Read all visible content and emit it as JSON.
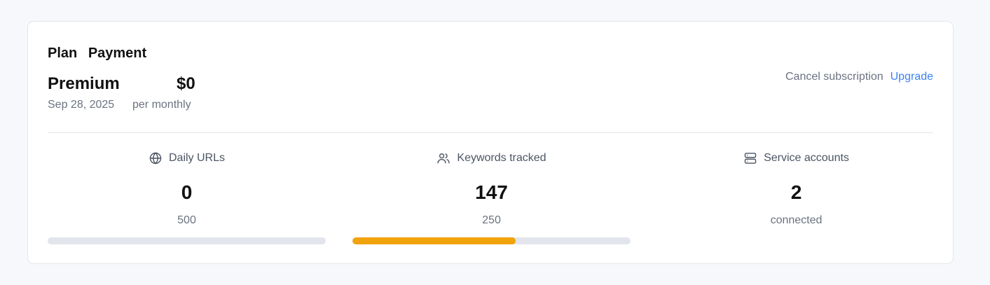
{
  "header": {
    "tabs": [
      "Plan",
      "Payment"
    ]
  },
  "plan": {
    "name": "Premium",
    "price": "$0",
    "date": "Sep 28, 2025",
    "period": "per monthly"
  },
  "actions": {
    "cancel_label": "Cancel subscription",
    "upgrade_label": "Upgrade"
  },
  "stats": [
    {
      "icon": "globe-icon",
      "label": "Daily URLs",
      "value": "0",
      "sub": "500",
      "progress": 0
    },
    {
      "icon": "users-icon",
      "label": "Keywords tracked",
      "value": "147",
      "sub": "250",
      "progress": 0.588
    },
    {
      "icon": "server-icon",
      "label": "Service accounts",
      "value": "2",
      "sub": "connected"
    }
  ],
  "colors": {
    "accent": "#3b82f6",
    "progress": "#f0a30a",
    "track": "#e2e6ec"
  }
}
